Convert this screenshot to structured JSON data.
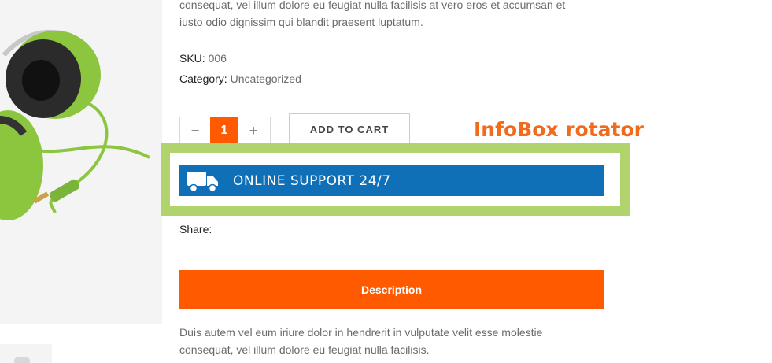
{
  "description_top": {
    "line1": "consequat, vel illum dolore eu feugiat nulla facilisis at vero eros et accumsan et",
    "line2": "iusto odio dignissim qui blandit praesent luptatum."
  },
  "meta": {
    "sku_label": "SKU:",
    "sku_value": "006",
    "category_label": "Category:",
    "category_value": "Uncategorized"
  },
  "quantity": {
    "minus": "−",
    "value": "1",
    "plus": "+"
  },
  "add_to_cart_label": "ADD TO CART",
  "infobox": {
    "title": "InfoBox rotator",
    "bar_text": "ONLINE SUPPORT 24/7",
    "icon": "truck-icon"
  },
  "share_label": "Share:",
  "tab": {
    "label": "Description"
  },
  "description_bottom": {
    "line1": "Duis autem vel eum iriure dolor in hendrerit in vulputate velit esse molestie",
    "line2": "consequat, vel illum dolore eu feugiat nulla facilisis."
  },
  "colors": {
    "accent": "#ff5a00",
    "infobox_frame": "#b0d36e",
    "infobox_bar": "#0f6fb7",
    "rotator_title": "#f26a1b"
  }
}
